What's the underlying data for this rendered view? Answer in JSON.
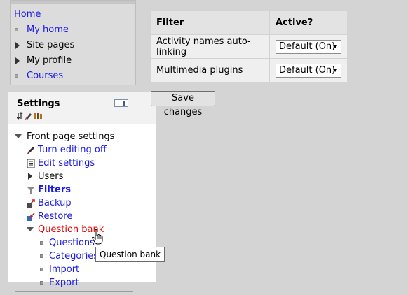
{
  "navigation": {
    "home_label": "Home",
    "items": [
      {
        "label": "My home",
        "style": "link",
        "marker": "bullet"
      },
      {
        "label": "Site pages",
        "style": "plain",
        "marker": "collapsed"
      },
      {
        "label": "My profile",
        "style": "plain",
        "marker": "collapsed"
      },
      {
        "label": "Courses",
        "style": "link",
        "marker": "bullet"
      }
    ]
  },
  "settings": {
    "title": "Settings",
    "front_page": {
      "label": "Front page settings",
      "items": [
        {
          "label": "Turn editing off",
          "icon": "pencil-icon"
        },
        {
          "label": "Edit settings",
          "icon": "settings-document-icon"
        },
        {
          "label": "Users",
          "icon": "collapsed-triangle"
        },
        {
          "label": "Filters",
          "icon": "filter-funnel-icon"
        },
        {
          "label": "Backup",
          "icon": "backup-icon"
        },
        {
          "label": "Restore",
          "icon": "restore-icon"
        },
        {
          "label": "Question bank",
          "icon": "expanded-triangle"
        }
      ],
      "question_bank_items": [
        "Questions",
        "Categories",
        "Import",
        "Export"
      ]
    }
  },
  "filter_table": {
    "headers": [
      "Filter",
      "Active?"
    ],
    "rows": [
      {
        "name": "Activity names auto-linking",
        "active": "Default (On)"
      },
      {
        "name": "Multimedia plugins",
        "active": "Default (On)"
      }
    ]
  },
  "save_button_label": "Save changes",
  "tooltip_text": "Question bank",
  "colors": {
    "link": "#1a1ae6",
    "hovered_link": "#e60000",
    "page_background": "#d4d4d4",
    "block_background": "#ffffff"
  }
}
